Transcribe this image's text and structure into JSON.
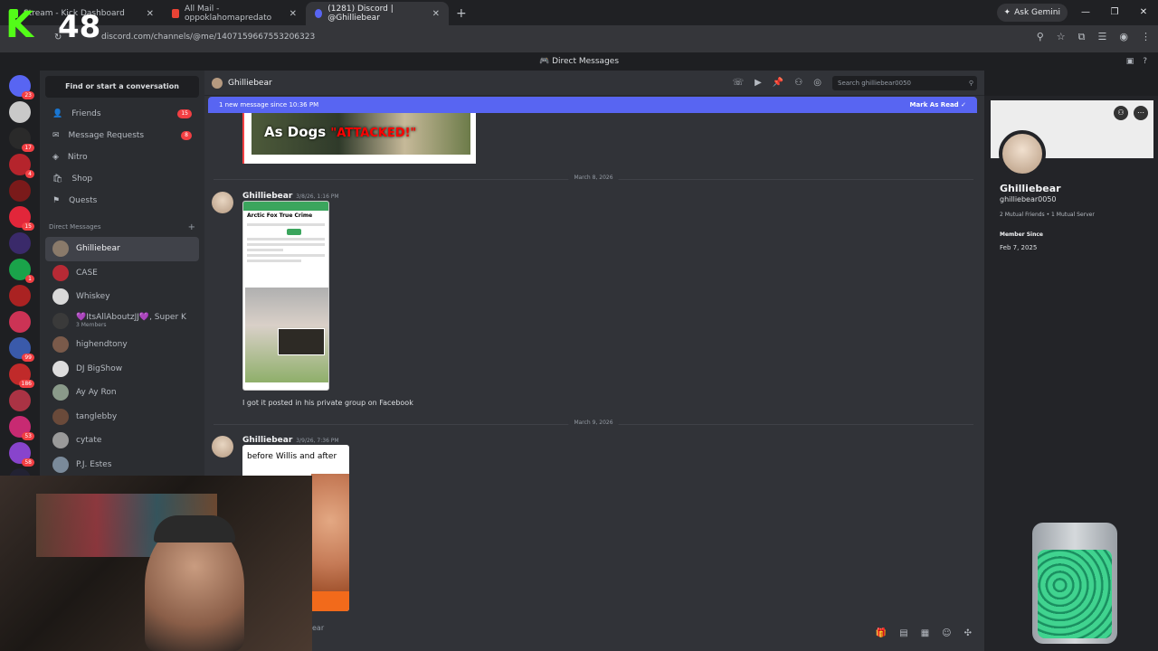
{
  "browser": {
    "tabs": [
      {
        "title": "Stream - Kick Dashboard",
        "active": false
      },
      {
        "title": "All Mail - oppoklahomapredato",
        "active": false
      },
      {
        "title": "(1281) Discord | @Ghilliebear",
        "active": true
      }
    ],
    "gemini_label": "Ask Gemini",
    "url": "discord.com/channels/@me/1407159667553206323"
  },
  "discord": {
    "top_title": "Direct Messages",
    "find_placeholder": "Find or start a conversation",
    "nav": [
      {
        "label": "Friends",
        "count": "15"
      },
      {
        "label": "Message Requests",
        "count": "8"
      },
      {
        "label": "Nitro",
        "count": ""
      },
      {
        "label": "Shop",
        "count": ""
      },
      {
        "label": "Quests",
        "count": ""
      }
    ],
    "dm_header": "Direct Messages",
    "dms": [
      {
        "name": "Ghilliebear",
        "sub": "",
        "active": true,
        "color": "#8a7a6a"
      },
      {
        "name": "CASE",
        "sub": "",
        "active": false,
        "color": "#b72a35"
      },
      {
        "name": "Whiskey",
        "sub": "",
        "active": false,
        "color": "#d9d9d9"
      },
      {
        "name": "💜ItsAllAboutzJJ💜, Super K",
        "sub": "3 Members",
        "active": false,
        "color": "#3a3a3a"
      },
      {
        "name": "highendtony",
        "sub": "",
        "active": false,
        "color": "#7a5a4a"
      },
      {
        "name": "DJ BigShow",
        "sub": "",
        "active": false,
        "color": "#dddddd"
      },
      {
        "name": "Ay Ay Ron",
        "sub": "",
        "active": false,
        "color": "#8a9a8a"
      },
      {
        "name": "tanglebby",
        "sub": "",
        "active": false,
        "color": "#6a4a3a"
      },
      {
        "name": "cytate",
        "sub": "",
        "active": false,
        "color": "#9a9a9a"
      },
      {
        "name": "P.J. Estes",
        "sub": "",
        "active": false,
        "color": "#7a8a9a"
      }
    ],
    "guild_badges": [
      "23",
      "",
      "17",
      "4",
      "",
      "15",
      "",
      "1",
      "",
      "",
      "99",
      "186",
      "",
      "53",
      "58",
      "1"
    ],
    "chat": {
      "title": "Ghilliebear",
      "search_placeholder": "Search ghilliebear0050",
      "new_banner": "1 new message since 10:36 PM",
      "mark_read": "Mark As Read",
      "image1_caption_white": "As Dogs",
      "image1_caption_red": "\"ATTACKED!\"",
      "divider1": "March 8, 2026",
      "msg1_author": "Ghilliebear",
      "msg1_time": "3/8/26, 1:16 PM",
      "phone_group": "Arctic Fox True Crime",
      "msg1_text": "I got it posted in his private group on Facebook",
      "divider2": "March 9, 2026",
      "msg2_author": "Ghilliebear",
      "msg2_time": "3/9/26, 7:36 PM",
      "image3_text": "before Willis and after"
    },
    "profile": {
      "name": "Ghilliebear",
      "username": "ghilliebear0050",
      "mutual": "2 Mutual Friends • 1 Mutual Server",
      "member_since_label": "Member Since",
      "member_since": "Feb 7, 2025"
    }
  },
  "stream_overlay": {
    "logo": "K",
    "count": "48",
    "partial_text": "ear"
  },
  "colors": {
    "accent": "#5865f2",
    "badge": "#f23f43",
    "kick_green": "#53fc18"
  }
}
